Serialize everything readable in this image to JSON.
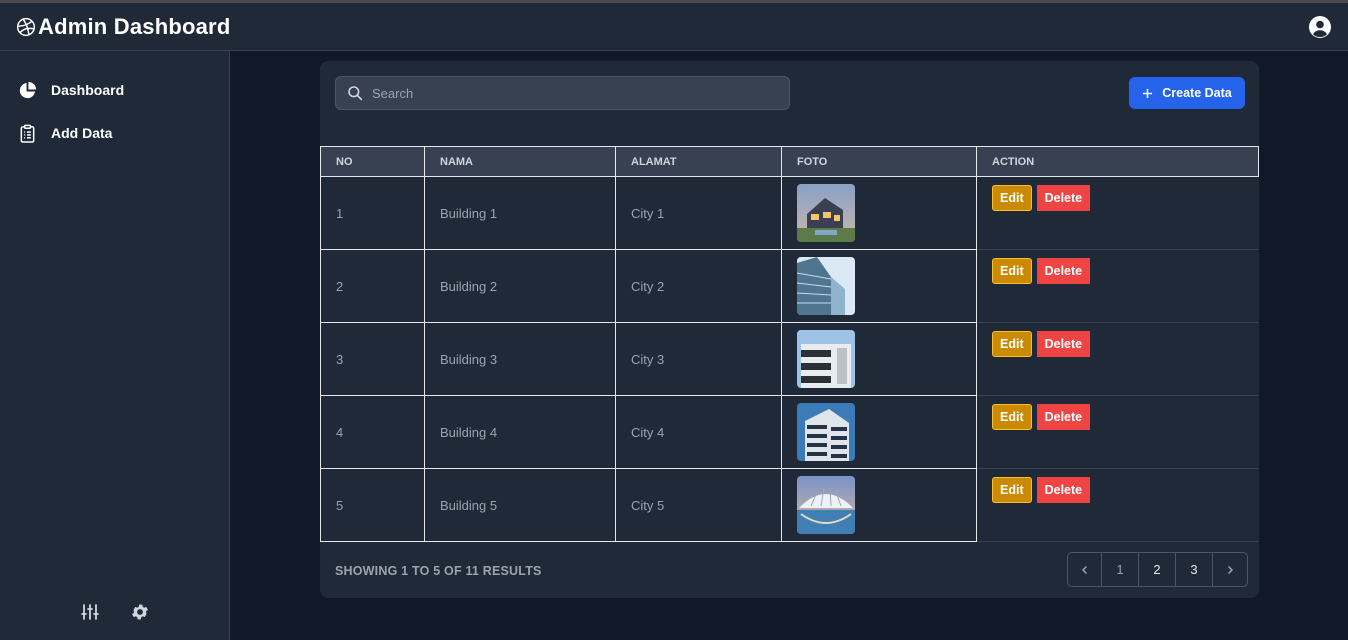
{
  "header": {
    "title": "Admin Dashboard"
  },
  "sidebar": {
    "items": [
      {
        "label": "Dashboard",
        "icon": "pie-chart-icon"
      },
      {
        "label": "Add Data",
        "icon": "clipboard-icon"
      }
    ],
    "bottom_icons": [
      "sliders-icon",
      "gear-icon"
    ]
  },
  "toolbar": {
    "search_placeholder": "Search",
    "create_label": "Create Data"
  },
  "table": {
    "columns": [
      "NO",
      "NAMA",
      "ALAMAT",
      "FOTO",
      "ACTION"
    ],
    "rows": [
      {
        "no": "1",
        "nama": "Building 1",
        "alamat": "City 1",
        "foto": "house-dusk"
      },
      {
        "no": "2",
        "nama": "Building 2",
        "alamat": "City 2",
        "foto": "glass-tower"
      },
      {
        "no": "3",
        "nama": "Building 3",
        "alamat": "City 3",
        "foto": "modern-facade"
      },
      {
        "no": "4",
        "nama": "Building 4",
        "alamat": "City 4",
        "foto": "balcony-tower"
      },
      {
        "no": "5",
        "nama": "Building 5",
        "alamat": "City 5",
        "foto": "futuristic-arch"
      }
    ],
    "edit_label": "Edit",
    "delete_label": "Delete"
  },
  "footer": {
    "results_text": "SHOWING 1 TO 5 OF 11 RESULTS",
    "pages": [
      "1",
      "2",
      "3"
    ]
  },
  "colors": {
    "accent": "#2563eb",
    "edit": "#ca8a04",
    "delete": "#ef4444"
  }
}
